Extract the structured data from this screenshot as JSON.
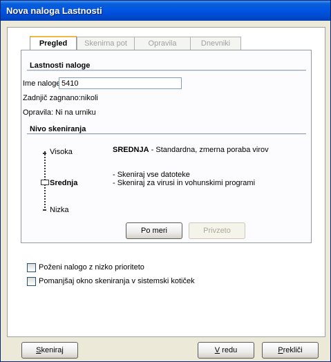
{
  "window": {
    "title": "Nova naloga Lastnosti"
  },
  "tabs": [
    {
      "label": "Pregled",
      "active": true
    },
    {
      "label": "Skenirna pot",
      "active": false
    },
    {
      "label": "Opravila",
      "active": false
    },
    {
      "label": "Dnevniki",
      "active": false
    }
  ],
  "task_properties": {
    "heading": "Lastnosti naloge",
    "name_label": "Ime naloge:",
    "name_value": "5410",
    "last_run": "Zadnjič zagnano:nikoli",
    "schedule": "Opravila: Ni na urniku"
  },
  "scan_level": {
    "heading": "Nivo skeniranja",
    "levels": [
      "Visoka",
      "Srednja",
      "Nizka"
    ],
    "selected": "Srednja",
    "desc_title": "SREDNJA",
    "desc_text": " - Standardna, zmerna poraba virov",
    "bullet_1": "- Skeniraj vse datoteke",
    "bullet_2": "- Skeniraj za virusi in vohunskimi programi",
    "custom_button": "Po meri",
    "default_button": "Privzeto"
  },
  "options": {
    "low_priority": "Poženi nalogo z nizko prioriteto",
    "minimize": "Pomanjšaj okno skeniranja v sistemski kotiček"
  },
  "footer": {
    "scan_first": "S",
    "scan_rest": "keniraj",
    "ok_first": "V",
    "ok_rest": " redu",
    "cancel_first": "P",
    "cancel_rest": "rekliči"
  },
  "colors": {
    "titlebar": "#0054e3",
    "tab_accent": "#f0b840"
  }
}
